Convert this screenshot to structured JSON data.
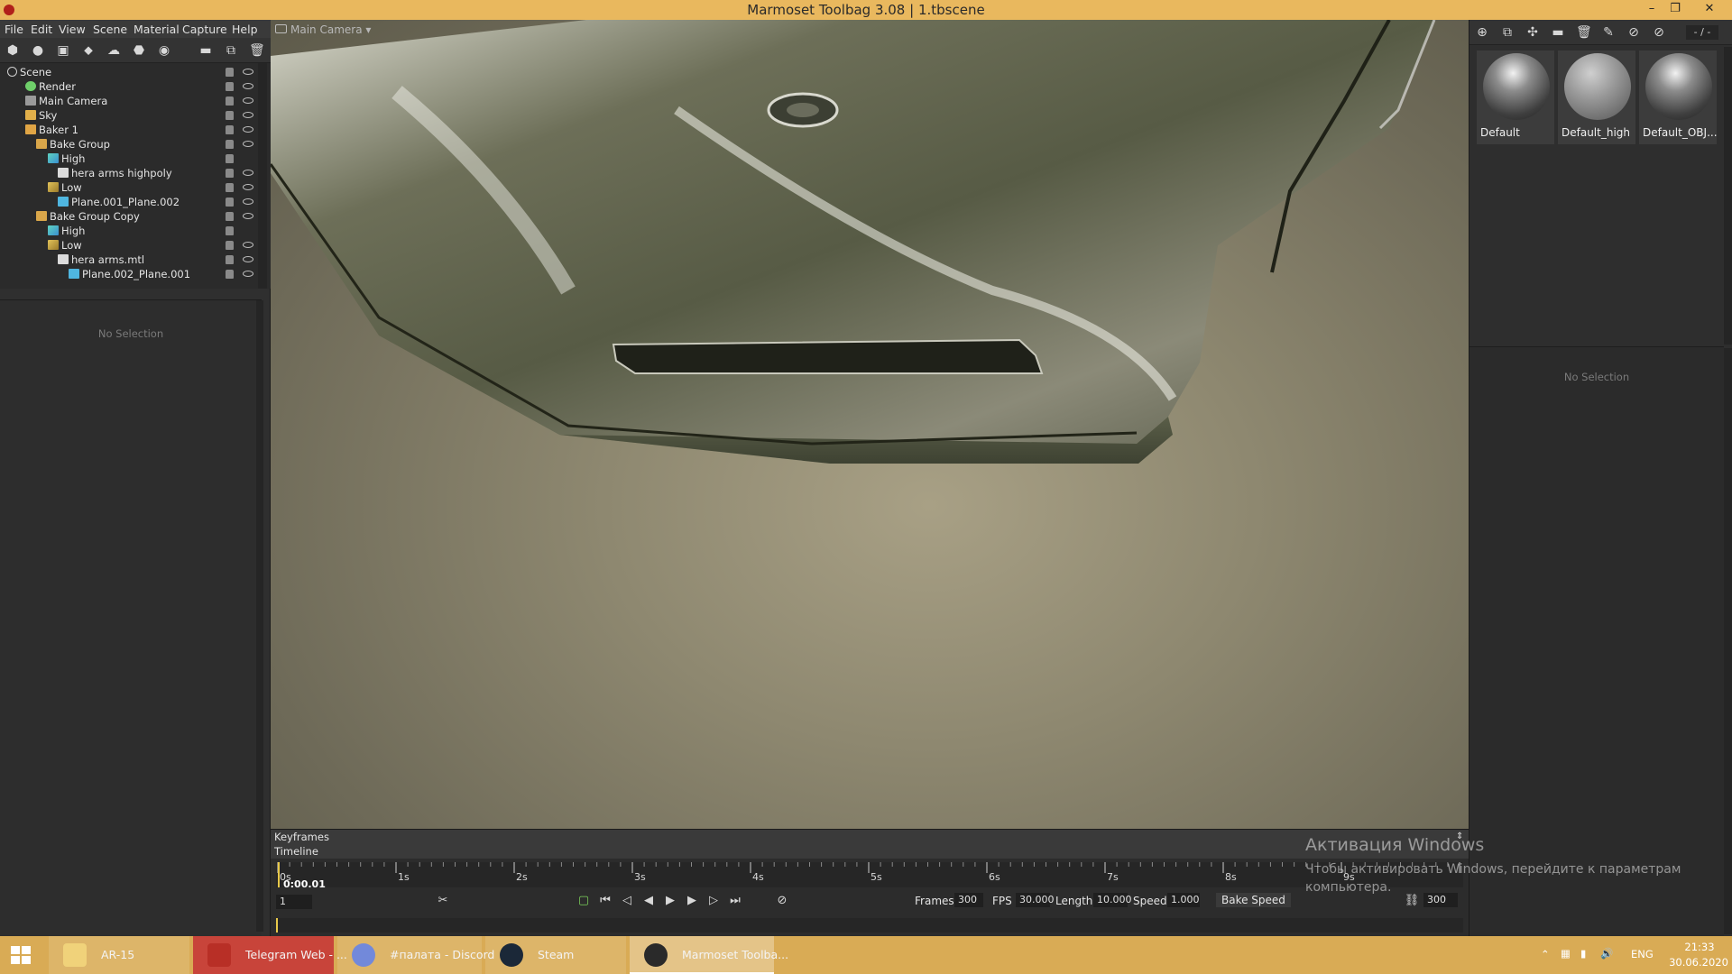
{
  "window": {
    "title": "Marmoset Toolbag 3.08  |  1.tbscene",
    "controls": [
      "–",
      "❐",
      "✕"
    ]
  },
  "menu": [
    "File",
    "Edit",
    "View",
    "Scene",
    "Material",
    "Capture",
    "Help"
  ],
  "scene_tree": {
    "items": [
      {
        "label": "Scene",
        "depth": 0,
        "icon": "scene-icon"
      },
      {
        "label": "Render",
        "depth": 1,
        "icon": "render-icon"
      },
      {
        "label": "Main Camera",
        "depth": 1,
        "icon": "camera-icon"
      },
      {
        "label": "Sky",
        "depth": 1,
        "icon": "sky-icon"
      },
      {
        "label": "Baker 1",
        "depth": 1,
        "icon": "baker-icon"
      },
      {
        "label": "Bake Group",
        "depth": 2,
        "icon": "folder-icon"
      },
      {
        "label": "High",
        "depth": 3,
        "icon": "high-icon"
      },
      {
        "label": "hera arms highpoly",
        "depth": 4,
        "icon": "mesh-file-icon"
      },
      {
        "label": "Low",
        "depth": 3,
        "icon": "low-icon"
      },
      {
        "label": "Plane.001_Plane.002",
        "depth": 4,
        "icon": "mesh-icon"
      },
      {
        "label": "Bake Group Copy",
        "depth": 2,
        "icon": "folder-icon"
      },
      {
        "label": "High",
        "depth": 3,
        "icon": "high-icon"
      },
      {
        "label": "Low",
        "depth": 3,
        "icon": "low-icon"
      },
      {
        "label": "hera arms.mtl",
        "depth": 4,
        "icon": "mesh-file-icon"
      },
      {
        "label": "Plane.002_Plane.001",
        "depth": 5,
        "icon": "mesh-icon"
      }
    ]
  },
  "left_properties": {
    "empty_text": "No Selection"
  },
  "viewport": {
    "camera_label": "Main Camera ▾"
  },
  "materials": {
    "counter": "- / -",
    "items": [
      {
        "name": "Default"
      },
      {
        "name": "Default_high"
      },
      {
        "name": "Default_OBJ..."
      }
    ]
  },
  "right_properties": {
    "empty_text": "No Selection"
  },
  "timeline": {
    "keyframes_label": "Keyframes",
    "timeline_label": "Timeline",
    "ticks": [
      "0s",
      "1s",
      "2s",
      "3s",
      "4s",
      "5s",
      "6s",
      "7s",
      "8s",
      "9s"
    ],
    "current_time": "0:00.01",
    "current_frame": "1",
    "frames_label": "Frames",
    "frames": "300",
    "fps_label": "FPS",
    "fps": "30.000",
    "length_label": "Length",
    "length": "10.000",
    "speed_label": "Speed",
    "speed": "1.000",
    "bake_speed_label": "Bake Speed",
    "end_frame": "300"
  },
  "watermark": {
    "title": "Активация Windows",
    "text": "Чтобы активировать Windows, перейдите к параметрам компьютера."
  },
  "taskbar": {
    "items": [
      {
        "label": "AR-15",
        "color": "#cfae64"
      },
      {
        "label": "Telegram Web - ...",
        "color": "#c8342c"
      },
      {
        "label": "#палата - Discord",
        "color": "#7289da"
      },
      {
        "label": "Steam",
        "color": "#1b2838"
      },
      {
        "label": "Marmoset Toolba...",
        "color": "#e0e0e0"
      }
    ],
    "tray": {
      "language": "ENG",
      "time": "21:33",
      "date": "30.06.2020"
    }
  }
}
